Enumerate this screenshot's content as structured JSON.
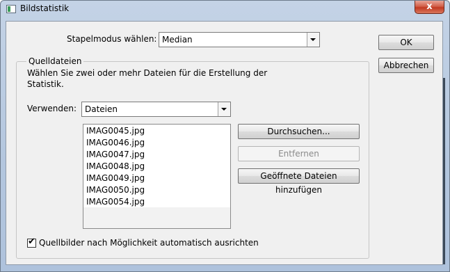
{
  "window": {
    "title": "Bildstatistik",
    "close_glyph": "x"
  },
  "stack_mode": {
    "label": "Stapelmodus wählen:",
    "value": "Median"
  },
  "buttons": {
    "ok": "OK",
    "cancel": "Abbrechen"
  },
  "source_files": {
    "group_title": "Quelldateien",
    "instructions_line1": "Wählen Sie zwei oder mehr Dateien für die Erstellung der",
    "instructions_line2": "Statistik.",
    "use_label": "Verwenden:",
    "use_value": "Dateien",
    "files": [
      "IMAG0045.jpg",
      "IMAG0046.jpg",
      "IMAG0047.jpg",
      "IMAG0048.jpg",
      "IMAG0049.jpg",
      "IMAG0050.jpg",
      "IMAG0054.jpg"
    ],
    "browse_button": "Durchsuchen...",
    "remove_button": "Entfernen",
    "add_open_button": "Geöffnete Dateien hinzufügen"
  },
  "auto_align": {
    "label": "Quellbilder nach Möglichkeit automatisch ausrichten",
    "checked": true
  }
}
